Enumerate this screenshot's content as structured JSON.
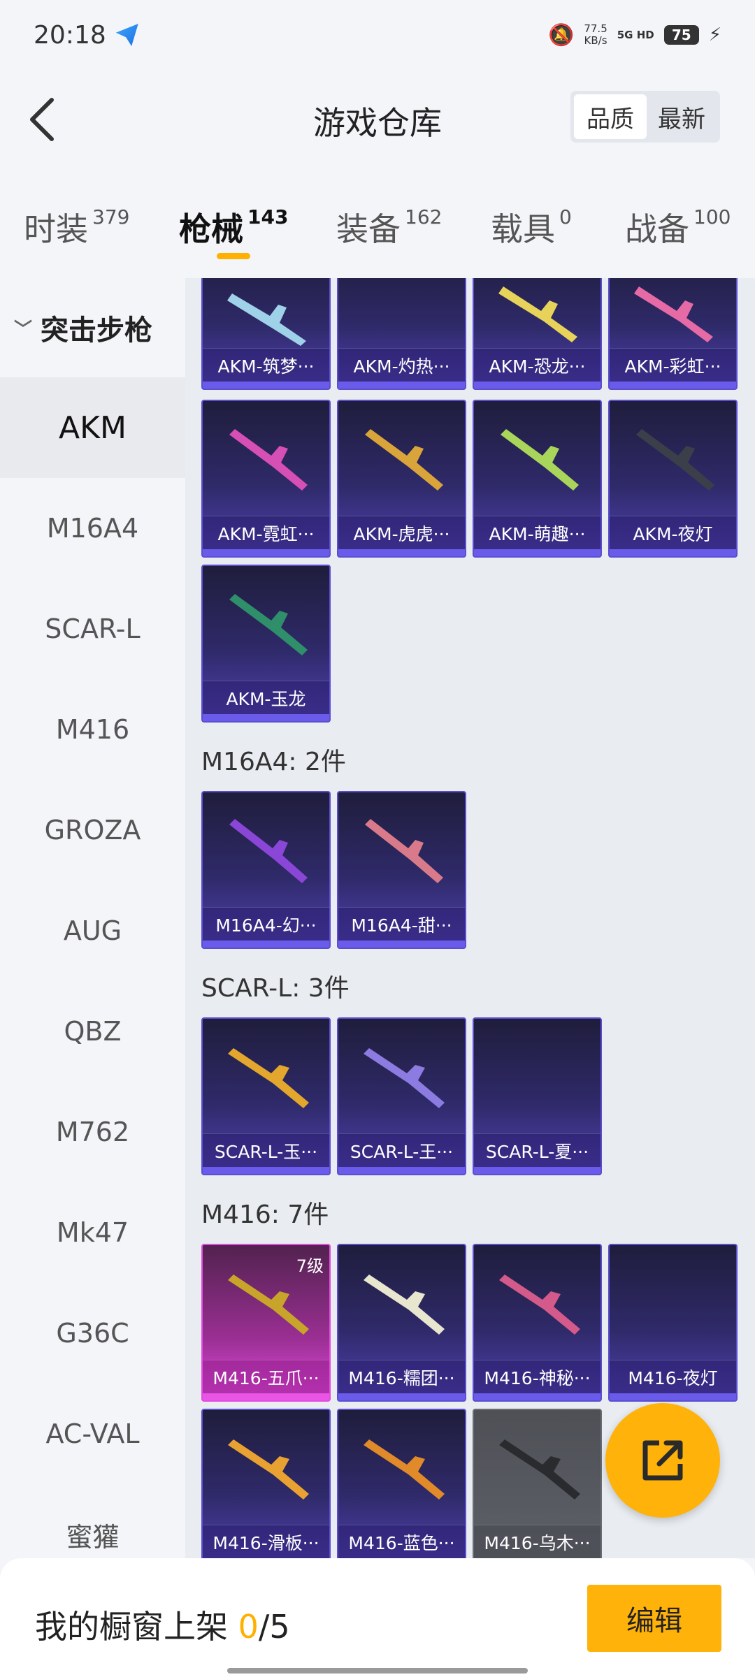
{
  "status_bar": {
    "time": "20:18",
    "speed_value": "77.5",
    "speed_unit": "KB/s",
    "network": "5G HD",
    "battery": "75"
  },
  "header": {
    "title": "游戏仓库",
    "sort_options": [
      "品质",
      "最新"
    ],
    "sort_selected": "品质"
  },
  "tabs": [
    {
      "label": "时装",
      "count": "379"
    },
    {
      "label": "枪械",
      "count": "143",
      "active": true
    },
    {
      "label": "装备",
      "count": "162"
    },
    {
      "label": "载具",
      "count": "0"
    },
    {
      "label": "战备",
      "count": "100"
    }
  ],
  "sidebar": {
    "group": "突击步枪",
    "items": [
      "AKM",
      "M16A4",
      "SCAR-L",
      "M416",
      "GROZA",
      "AUG",
      "QBZ",
      "M762",
      "Mk47",
      "G36C",
      "AC-VAL",
      "蜜獾"
    ],
    "active": "AKM"
  },
  "sections": {
    "akm": {
      "items": [
        "AKM-筑梦···",
        "AKM-灼热···",
        "AKM-恐龙···",
        "AKM-彩虹···",
        "AKM-霓虹···",
        "AKM-虎虎···",
        "AKM-萌趣···",
        "AKM-夜灯",
        "AKM-玉龙"
      ]
    },
    "m16a4": {
      "title": "M16A4: 2件",
      "items": [
        "M16A4-幻···",
        "M16A4-甜···"
      ]
    },
    "scarl": {
      "title": "SCAR-L: 3件",
      "items": [
        "SCAR-L-玉···",
        "SCAR-L-王···",
        "SCAR-L-夏···"
      ]
    },
    "m416": {
      "title": "M416: 7件",
      "items": [
        "M416-五爪···",
        "M416-糯团···",
        "M416-神秘···",
        "M416-夜灯",
        "M416-滑板···",
        "M416-蓝色···",
        "M416-乌木···"
      ],
      "first_level_badge": "7级"
    }
  },
  "bottom": {
    "showcase_label": "我的橱窗上架",
    "showcase_count": "0",
    "showcase_total": "/5",
    "edit_label": "编辑"
  },
  "colors": {
    "accent": "#ffb20a",
    "card_purple": "#5242b3",
    "card_pink": "#e14be0"
  }
}
